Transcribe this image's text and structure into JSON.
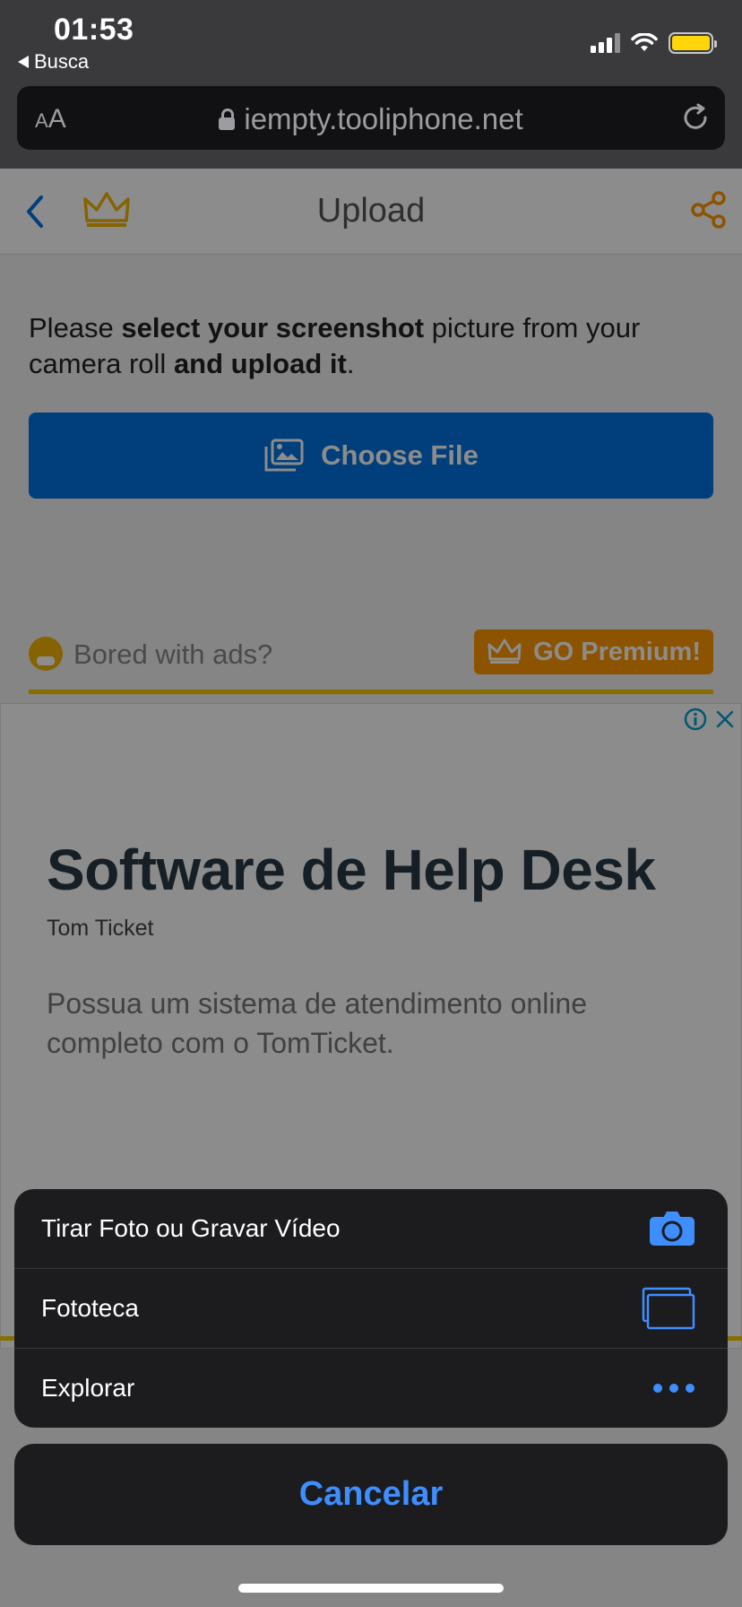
{
  "status_bar": {
    "time": "01:53",
    "back_app": "Busca"
  },
  "browser": {
    "text_size_label_small": "A",
    "text_size_label_large": "A",
    "url": "iempty.tooliphone.net"
  },
  "page": {
    "nav_title": "Upload",
    "intro": {
      "part1": "Please ",
      "bold1": "select your screenshot",
      "part2": " picture from your camera roll ",
      "bold2": "and upload it",
      "part3": "."
    },
    "choose_file_label": "Choose File",
    "bored_text": "Bored with ads?",
    "go_premium_label": "GO Premium!",
    "accent_blue": "#0073e0",
    "accent_orange": "#ff9800",
    "accent_gold": "#f7c600"
  },
  "ad": {
    "title": "Software de Help Desk",
    "brand": "Tom Ticket",
    "description": "Possua um sistema de atendimento online completo com o TomTicket."
  },
  "action_sheet": {
    "items": [
      {
        "label": "Tirar Foto ou Gravar Vídeo",
        "icon": "camera-icon"
      },
      {
        "label": "Fototeca",
        "icon": "photo-library-icon"
      },
      {
        "label": "Explorar",
        "icon": "more-icon"
      }
    ],
    "cancel_label": "Cancelar",
    "accent": "#3e8eff"
  }
}
